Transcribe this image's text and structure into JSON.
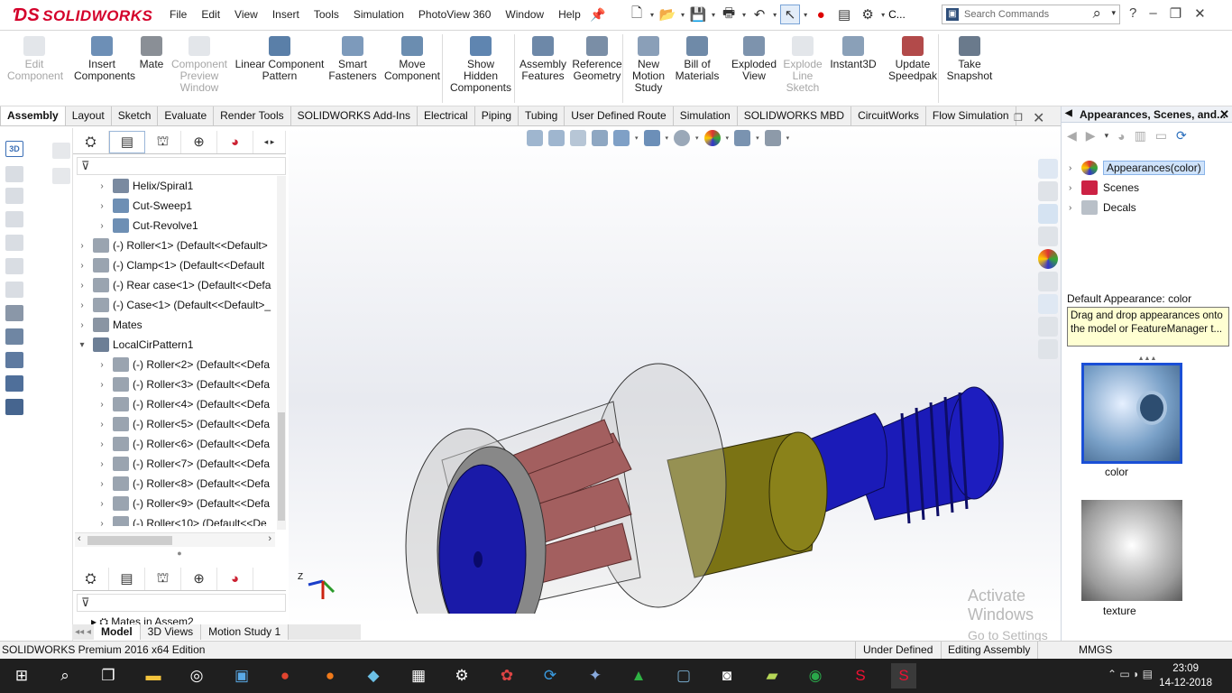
{
  "app": {
    "logo": "SOLIDWORKS",
    "menu": [
      "File",
      "Edit",
      "View",
      "Insert",
      "Tools",
      "Simulation",
      "PhotoView 360",
      "Window",
      "Help"
    ],
    "search_placeholder": "Search Commands",
    "more_label": "C..."
  },
  "ribbon": [
    {
      "label": "Edit\nComponent",
      "enabled": false
    },
    {
      "label": "Insert\nComponents",
      "enabled": true
    },
    {
      "label": "Mate",
      "enabled": true
    },
    {
      "label": "Component\nPreview\nWindow",
      "enabled": false
    },
    {
      "label": "Linear Component\nPattern",
      "enabled": true
    },
    {
      "label": "Smart\nFasteners",
      "enabled": true
    },
    {
      "label": "Move\nComponent",
      "enabled": true
    },
    {
      "label": "Show\nHidden\nComponents",
      "enabled": true
    },
    {
      "label": "Assembly\nFeatures",
      "enabled": true
    },
    {
      "label": "Reference\nGeometry",
      "enabled": true
    },
    {
      "label": "New\nMotion\nStudy",
      "enabled": true
    },
    {
      "label": "Bill of\nMaterials",
      "enabled": true
    },
    {
      "label": "Exploded\nView",
      "enabled": true
    },
    {
      "label": "Explode\nLine\nSketch",
      "enabled": false
    },
    {
      "label": "Instant3D",
      "enabled": true
    },
    {
      "label": "Update\nSpeedpak",
      "enabled": true
    },
    {
      "label": "Take\nSnapshot",
      "enabled": true
    }
  ],
  "tabs": [
    "Assembly",
    "Layout",
    "Sketch",
    "Evaluate",
    "Render Tools",
    "SOLIDWORKS Add-Ins",
    "Electrical",
    "Piping",
    "Tubing",
    "User Defined Route",
    "Simulation",
    "SOLIDWORKS MBD",
    "CircuitWorks",
    "Flow Simulation"
  ],
  "active_tab": "Assembly",
  "tree": [
    {
      "label": "Helix/Spiral1",
      "indent": 1
    },
    {
      "label": "Cut-Sweep1",
      "indent": 1
    },
    {
      "label": "Cut-Revolve1",
      "indent": 1
    },
    {
      "label": "(-) Roller<1> (Default<<Default>",
      "indent": 0
    },
    {
      "label": "(-) Clamp<1> (Default<<Default",
      "indent": 0
    },
    {
      "label": "(-) Rear case<1> (Default<<Defa",
      "indent": 0
    },
    {
      "label": "(-) Case<1> (Default<<Default>_",
      "indent": 0
    },
    {
      "label": "Mates",
      "indent": 0
    },
    {
      "label": "LocalCirPattern1",
      "indent": 0,
      "open": true
    },
    {
      "label": "(-) Roller<2> (Default<<Defa",
      "indent": 1
    },
    {
      "label": "(-) Roller<3> (Default<<Defa",
      "indent": 1
    },
    {
      "label": "(-) Roller<4> (Default<<Defa",
      "indent": 1
    },
    {
      "label": "(-) Roller<5> (Default<<Defa",
      "indent": 1
    },
    {
      "label": "(-) Roller<6> (Default<<Defa",
      "indent": 1
    },
    {
      "label": "(-) Roller<7> (Default<<Defa",
      "indent": 1
    },
    {
      "label": "(-) Roller<8> (Default<<Defa",
      "indent": 1
    },
    {
      "label": "(-) Roller<9> (Default<<Defa",
      "indent": 1
    },
    {
      "label": "(-) Roller<10> (Default<<De",
      "indent": 1
    }
  ],
  "tree2_item": "Mates in Assem2",
  "bottom_tabs": [
    "Model",
    "3D Views",
    "Motion Study 1"
  ],
  "task_pane": {
    "title": "Appearances, Scenes, and...",
    "items": [
      "Appearances(color)",
      "Scenes",
      "Decals"
    ],
    "default_label": "Default Appearance: color",
    "tooltip": "Drag and drop appearances onto the model or FeatureManager t...",
    "thumb1": "color",
    "thumb2": "texture"
  },
  "watermark": {
    "line1": "Activate Windows",
    "line2": "Go to Settings to activate Windows."
  },
  "status": {
    "left": "SOLIDWORKS Premium 2016 x64 Edition",
    "s1": "Under Defined",
    "s2": "Editing Assembly",
    "s3": "MMGS"
  },
  "clock": {
    "time": "23:09",
    "date": "14-12-2018"
  },
  "colors": {
    "accent": "#2a6ebd",
    "brand": "#d4002a",
    "blue_part": "#1b1bb8",
    "olive_part": "#7b7314",
    "roller": "#a35f5f"
  }
}
